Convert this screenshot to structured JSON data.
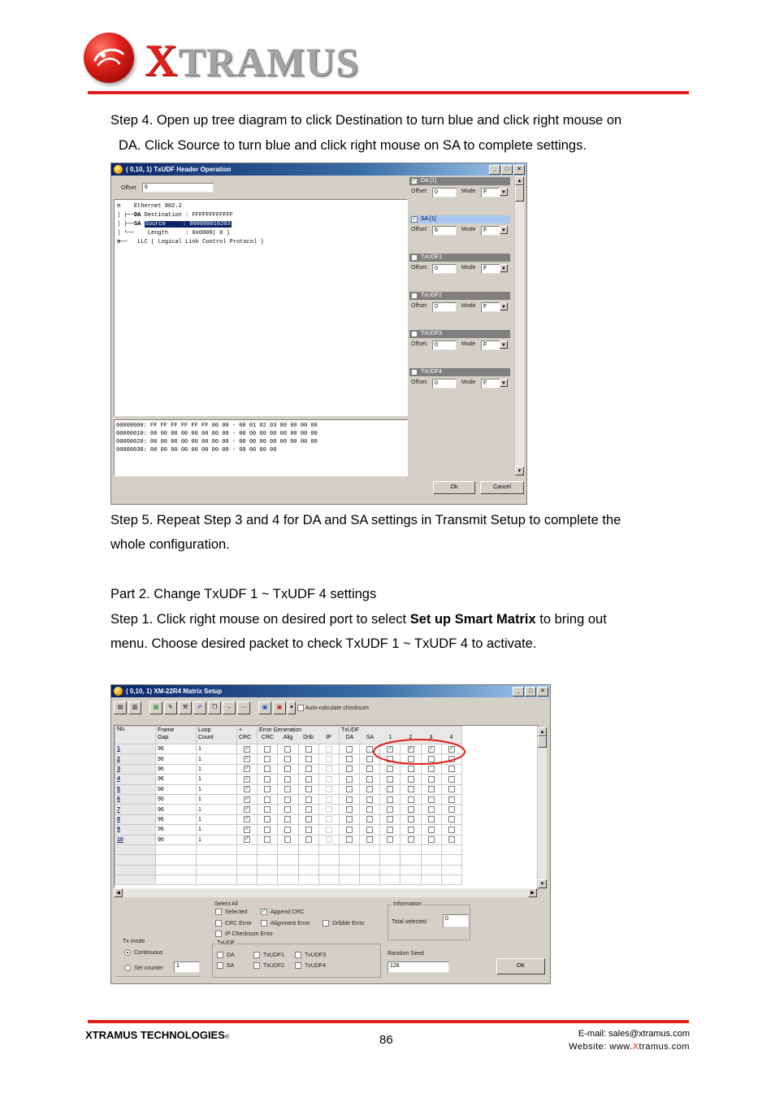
{
  "header": {
    "logo_text_x": "X",
    "logo_text_rest": "TRAMUS",
    "logo_reg": "®"
  },
  "step4": {
    "line1": "Step 4. Open up tree diagram to click Destination to turn blue and click right mouse on",
    "line2": "DA. Click Source to turn blue and click right mouse on SA to complete settings."
  },
  "win1": {
    "title": "( 0,10, 1) TxUDF Header Operation",
    "offset_label": "Offset",
    "offset_value": "6",
    "tree": [
      {
        "prefix": "⊟",
        "text": "Ethernet 802.2"
      },
      {
        "prefix": "│ ├──",
        "key": "DA",
        "text": "Destination",
        "value": ": FFFFFFFFFFFF"
      },
      {
        "prefix": "│ ├──",
        "key": "SA",
        "text": "Source",
        "value": ": 000000010203",
        "selected": true
      },
      {
        "prefix": "│ └──",
        "key": "",
        "text": "Length",
        "value": ": 0x0000( 0 )"
      },
      {
        "prefix": "⊞──",
        "text": "LLC ( Logical Link Control Protocol )"
      }
    ],
    "hex": [
      "00000000: FF FF FF FF FF FF 00 00 - 00 01 02 03 00 00 00 00",
      "00000010: 00 00 00 00 00 00 00 00 - 00 00 00 00 00 00 00 00",
      "00000020: 00 00 00 00 00 00 00 00 - 00 00 00 00 00 00 00 00",
      "00000030: 00 00 00 00 00 00 00 00 - 00 00 00 00"
    ],
    "udf_sections": [
      {
        "name": "DA [1]",
        "checked": true,
        "selected": false,
        "offset": "0",
        "mode": "F"
      },
      {
        "name": "SA [1]",
        "checked": true,
        "selected": true,
        "offset": "6",
        "mode": "F"
      },
      {
        "name": "TxUDF1",
        "checked": false,
        "selected": false,
        "offset": "0",
        "mode": "F"
      },
      {
        "name": "TxUDF2",
        "checked": false,
        "selected": false,
        "offset": "0",
        "mode": "F"
      },
      {
        "name": "TxUDF3",
        "checked": false,
        "selected": false,
        "offset": "0",
        "mode": "F"
      },
      {
        "name": "TxUDF4",
        "checked": false,
        "selected": false,
        "offset": "0",
        "mode": "F"
      }
    ],
    "offset_field_label": "Offset:",
    "mode_label": "Mode",
    "ok": "Ok",
    "cancel": "Cancel"
  },
  "step5": {
    "line1": "Step 5. Repeat Step 3 and 4 for DA and SA settings in Transmit Setup to complete the",
    "line2": "whole configuration."
  },
  "part2": {
    "heading": "Part 2. Change TxUDF 1 ~ TxUDF 4 settings",
    "step1_a": "Step 1. Click right mouse on desired port to select ",
    "step1_bold": "Set up Smart Matrix",
    "step1_b": " to bring out",
    "step1_line2": "menu. Choose desired packet to check TxUDF 1 ~ TxUDF 4 to activate."
  },
  "win2": {
    "title": "( 0,10, 1) XM-22R4 Matrix Setup",
    "auto_checksum": "Auto-calculate checksum",
    "headers": {
      "no": "No.",
      "frame": "Frame",
      "gap": "Gap",
      "loop": "Loop",
      "count": "Count",
      "plus": "+",
      "crc": "CRC",
      "errgen": "Error Generation",
      "crc2": "CRC",
      "alig": "Alig",
      "drib": "Drib",
      "ip": "IP",
      "txudf": "TxUDF",
      "da": "DA",
      "sa": "SA",
      "u1": "1",
      "u2": "2",
      "u3": "3",
      "u4": "4"
    },
    "rows": [
      {
        "no": "1",
        "gap": "96",
        "count": "1",
        "udf": [
          true,
          true,
          true,
          true
        ]
      },
      {
        "no": "2",
        "gap": "96",
        "count": "1",
        "udf": [
          false,
          false,
          false,
          false
        ]
      },
      {
        "no": "3",
        "gap": "96",
        "count": "1",
        "udf": [
          false,
          false,
          false,
          false
        ]
      },
      {
        "no": "4",
        "gap": "96",
        "count": "1",
        "udf": [
          false,
          false,
          false,
          false
        ]
      },
      {
        "no": "5",
        "gap": "96",
        "count": "1",
        "udf": [
          false,
          false,
          false,
          false
        ]
      },
      {
        "no": "6",
        "gap": "96",
        "count": "1",
        "udf": [
          false,
          false,
          false,
          false
        ]
      },
      {
        "no": "7",
        "gap": "96",
        "count": "1",
        "udf": [
          false,
          false,
          false,
          false
        ]
      },
      {
        "no": "8",
        "gap": "96",
        "count": "1",
        "udf": [
          false,
          false,
          false,
          false
        ]
      },
      {
        "no": "9",
        "gap": "96",
        "count": "1",
        "udf": [
          false,
          false,
          false,
          false
        ]
      },
      {
        "no": "10",
        "gap": "96",
        "count": "1",
        "udf": [
          false,
          false,
          false,
          false
        ]
      }
    ],
    "txmode_label": "Tx mode",
    "continuous": "Continuous",
    "set_counter": "Set counter",
    "set_counter_value": "1",
    "select_all": "Select All",
    "selected": "Selected",
    "append_crc": "Append CRC",
    "crc_error": "CRC Error",
    "alignment_error": "Alignment Error",
    "dribble_error": "Dribble Error",
    "ip_checksum_error": "IP Checksum Error",
    "txudf_label": "TxUDF",
    "da": "DA",
    "sa": "SA",
    "txudf1": "TxUDF1",
    "txudf2": "TxUDF2",
    "txudf3": "TxUDF3",
    "txudf4": "TxUDF4",
    "information": "Information",
    "total_selected": "Total selected",
    "total_value": "0",
    "random_seed": "Random Seed",
    "random_value": "128",
    "ok": "OK"
  },
  "footer": {
    "company": "XTRAMUS TECHNOLOGIES",
    "reg": "®",
    "page": "86",
    "email": "E-mail: sales@xtramus.com",
    "website_a": "Website:  www.",
    "website_x": "X",
    "website_b": "tramus.com"
  },
  "colors": {
    "accent": "#e0201a",
    "title_bar": "#0a246a"
  }
}
